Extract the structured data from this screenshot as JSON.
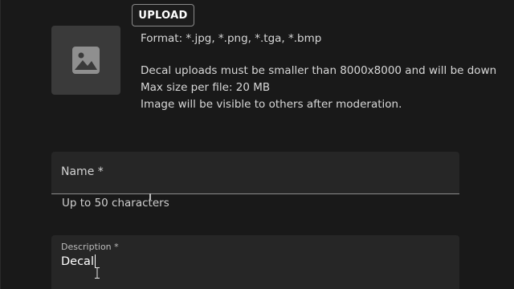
{
  "upload": {
    "button_label": "UPLOAD"
  },
  "thumbnail": {
    "icon": "image-placeholder-icon"
  },
  "info": {
    "format": "Format: *.jpg, *.png, *.tga, *.bmp",
    "size_limit": "Decal uploads must be smaller than 8000x8000 and will be down",
    "max_size": "Max size per file: 20 MB",
    "moderation": "Image will be visible to others after moderation."
  },
  "name_field": {
    "label": "Name *",
    "value": "",
    "helper": "Up to 50 characters"
  },
  "description_field": {
    "label": "Description *",
    "value": "Decal"
  }
}
